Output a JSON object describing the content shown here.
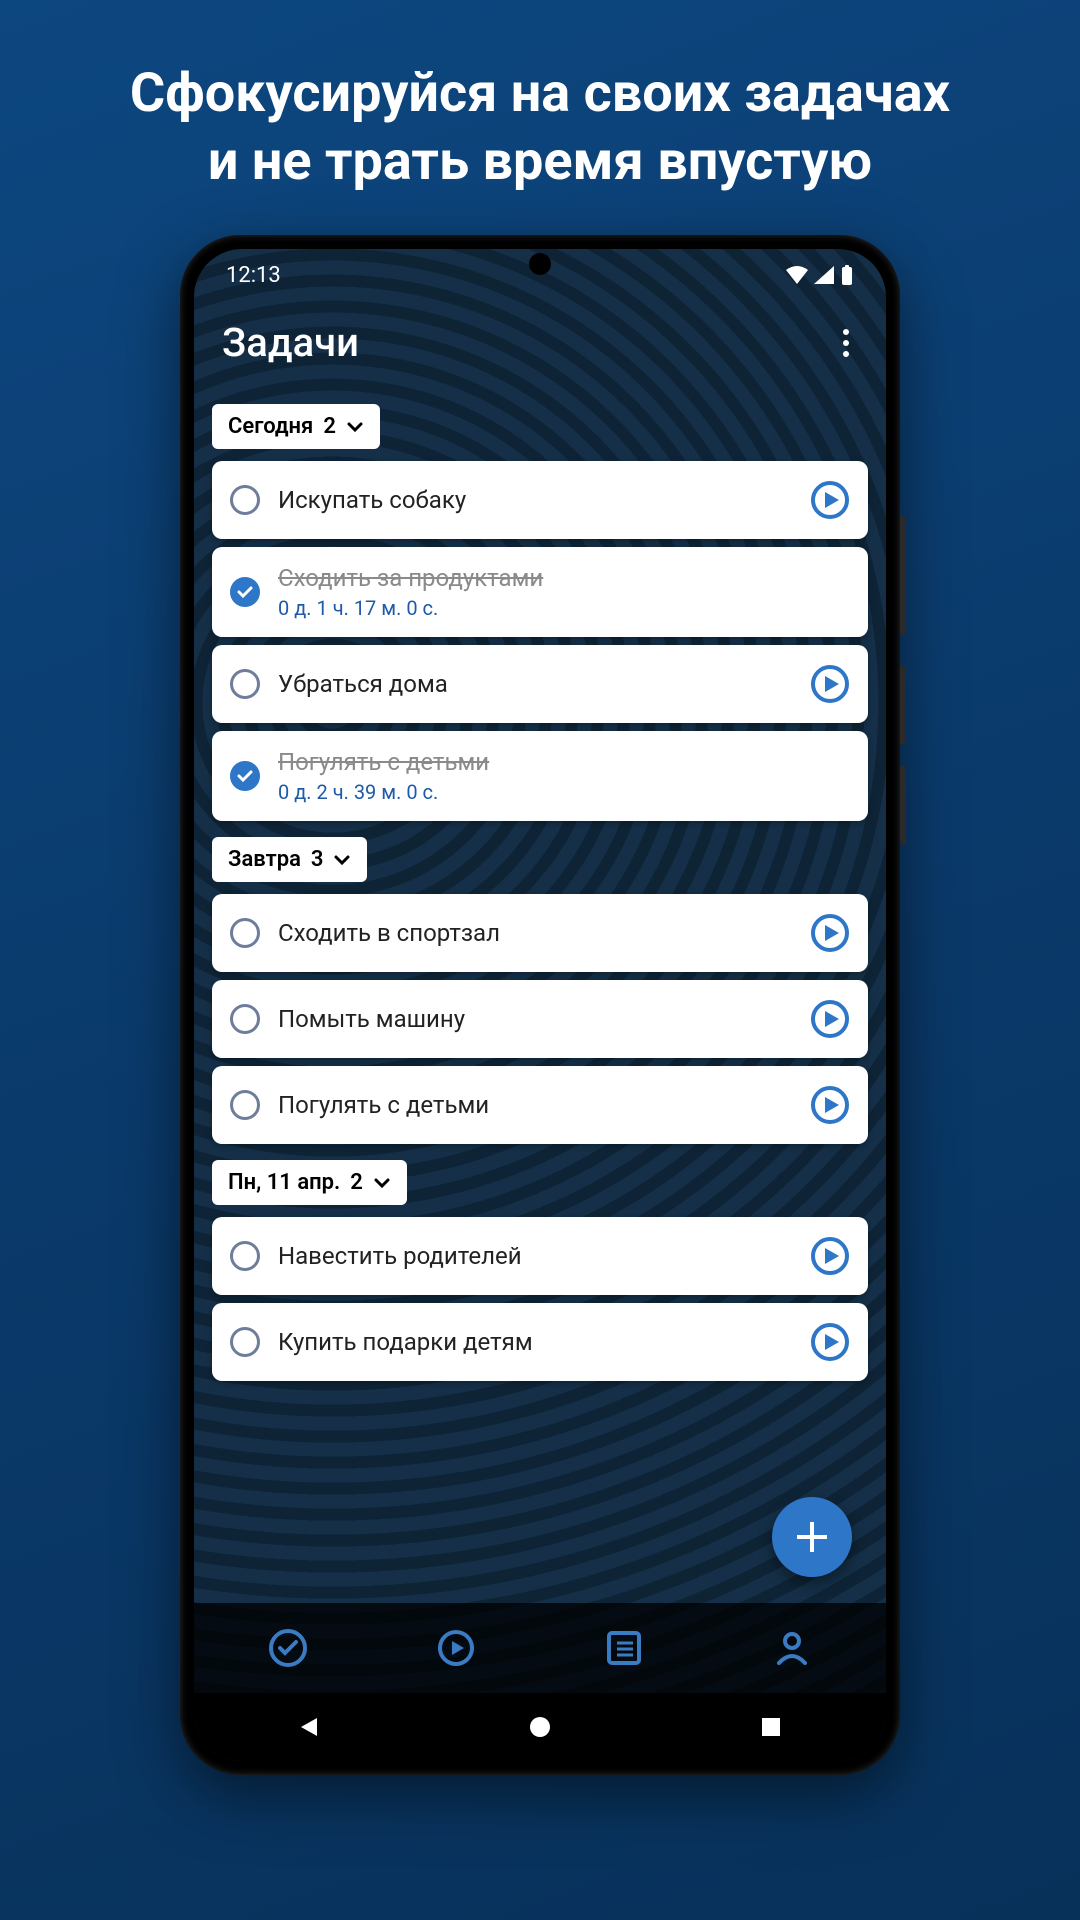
{
  "promo": {
    "line1": "Сфокусируйся на своих задачах",
    "line2": "и не трать время впустую"
  },
  "status": {
    "time": "12:13"
  },
  "header": {
    "title": "Задачи"
  },
  "colors": {
    "accent": "#2e76c8"
  },
  "sections": [
    {
      "label": "Сегодня",
      "count": "2",
      "tasks": [
        {
          "title": "Искупать собаку",
          "done": false,
          "sub": "",
          "play": true
        },
        {
          "title": "Сходить за продуктами",
          "done": true,
          "sub": "0 д. 1 ч. 17 м. 0 с.",
          "play": false
        },
        {
          "title": "Убраться дома",
          "done": false,
          "sub": "",
          "play": true
        },
        {
          "title": "Погулять с детьми",
          "done": true,
          "sub": "0 д. 2 ч. 39 м. 0 с.",
          "play": false
        }
      ]
    },
    {
      "label": "Завтра",
      "count": "3",
      "tasks": [
        {
          "title": "Сходить в спортзал",
          "done": false,
          "sub": "",
          "play": true
        },
        {
          "title": "Помыть машину",
          "done": false,
          "sub": "",
          "play": true
        },
        {
          "title": "Погулять с детьми",
          "done": false,
          "sub": "",
          "play": true
        }
      ]
    },
    {
      "label": "Пн, 11 апр.",
      "count": "2",
      "tasks": [
        {
          "title": "Навестить родителей",
          "done": false,
          "sub": "",
          "play": true
        },
        {
          "title": "Купить подарки детям",
          "done": false,
          "sub": "",
          "play": true
        }
      ]
    }
  ]
}
